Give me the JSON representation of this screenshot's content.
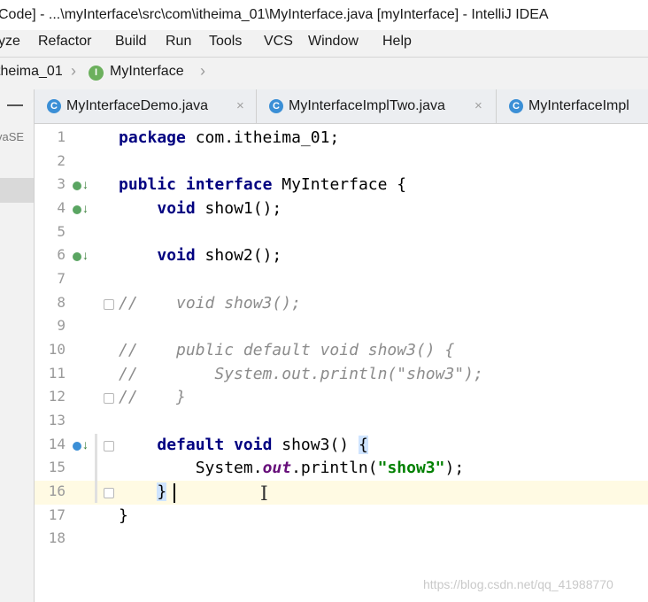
{
  "window": {
    "title": "Code] - ...\\myInterface\\src\\com\\itheima_01\\MyInterface.java [myInterface] - IntelliJ IDEA"
  },
  "menu": [
    {
      "label": "yze",
      "name": "menu-analyze"
    },
    {
      "label": "Refactor",
      "name": "menu-refactor"
    },
    {
      "label": "Build",
      "name": "menu-build"
    },
    {
      "label": "Run",
      "name": "menu-run"
    },
    {
      "label": "Tools",
      "name": "menu-tools"
    },
    {
      "label": "VCS",
      "name": "menu-vcs"
    },
    {
      "label": "Window",
      "name": "menu-window"
    },
    {
      "label": "Help",
      "name": "menu-help"
    }
  ],
  "breadcrumb": {
    "package": "theima_01",
    "class": "MyInterface",
    "class_icon_letter": "I"
  },
  "project_panel": {
    "collapse_icon": "minus-icon",
    "library_label": "vaSE"
  },
  "tabs": [
    {
      "label": "MyInterfaceDemo.java",
      "icon_letter": "C",
      "close": "×"
    },
    {
      "label": "MyInterfaceImplTwo.java",
      "icon_letter": "C",
      "close": "×"
    },
    {
      "label": "MyInterfaceImpl",
      "icon_letter": "C",
      "close": ""
    }
  ],
  "line_numbers": [
    "1",
    "2",
    "3",
    "4",
    "5",
    "6",
    "7",
    "8",
    "9",
    "10",
    "11",
    "12",
    "13",
    "14",
    "15",
    "16",
    "17",
    "18"
  ],
  "code_lines": [
    "package com.itheima_01;",
    "",
    "public interface MyInterface {",
    "    void show1();",
    "",
    "    void show2();",
    "",
    "//    void show3();",
    "",
    "//    public default void show3() {",
    "//        System.out.println(\"show3\");",
    "//    }",
    "",
    "    default void show3() {",
    "        System.out.println(\"show3\");",
    "    }",
    "}",
    ""
  ],
  "code_tokens": {
    "l1_kw": "package",
    "l1_rest": " com.itheima_01;",
    "l3_kw1": "public",
    "l3_kw2": "interface",
    "l3_rest": " MyInterface {",
    "l4_kw": "void",
    "l4_rest": " show1();",
    "l6_kw": "void",
    "l6_rest": " show2();",
    "l8_cm": "//    void show3();",
    "l10_cm": "//    public default void show3() {",
    "l11_cm": "//        System.out.println(\"show3\");",
    "l12_cm": "//    }",
    "l14_kw1": "default",
    "l14_kw2": "void",
    "l14_rest": " show3() ",
    "l14_brace": "{",
    "l15_a": "System.",
    "l15_fld": "out",
    "l15_b": ".println(",
    "l15_str": "\"show3\"",
    "l15_c": ");",
    "l16_brace": "}",
    "l17": "}"
  },
  "gutter_icons": [
    "implemented-icon",
    "implemented-icon",
    "implemented-icon",
    "implemented-icon"
  ],
  "colors": {
    "keyword": "#000080",
    "comment": "#8c8c8c",
    "string": "#008000",
    "field": "#660e7a",
    "current_line": "#fffae3"
  },
  "watermark": "https://blog.csdn.net/qq_41988770"
}
